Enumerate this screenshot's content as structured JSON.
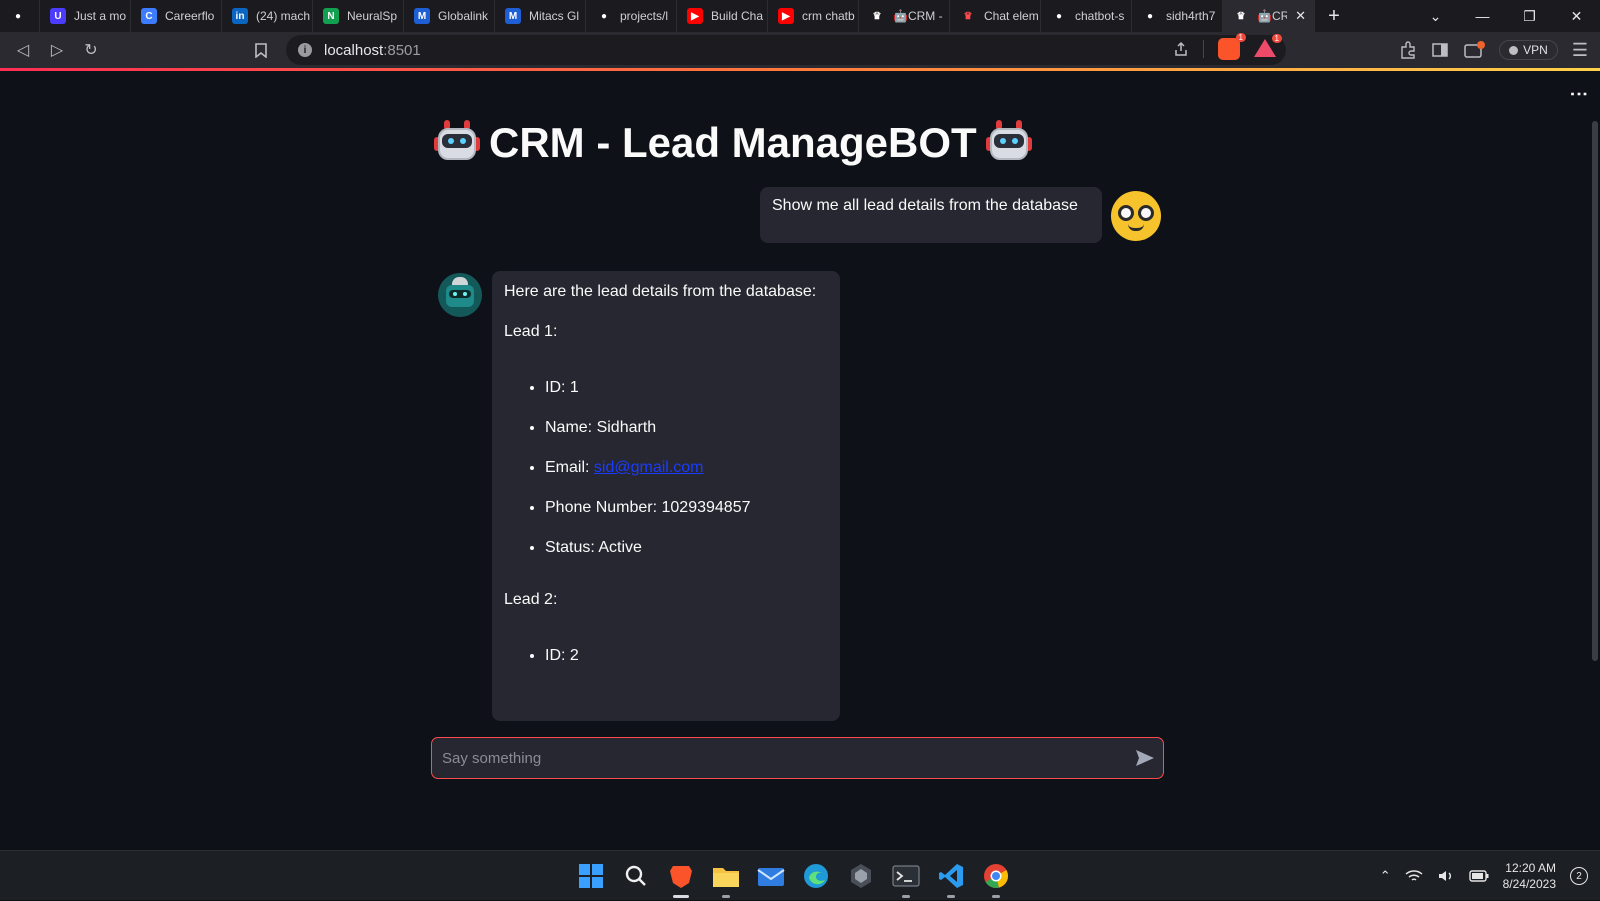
{
  "browser": {
    "tabs": [
      {
        "label": "",
        "icon": "github-icon",
        "color": "#ffffff"
      },
      {
        "label": "Just a mo",
        "icon": "un-icon",
        "color": "#4b3cff"
      },
      {
        "label": "Careerflo",
        "icon": "careerflow-icon",
        "color": "#3d7bff"
      },
      {
        "label": "(24) mach",
        "icon": "linkedin-icon",
        "color": "#0a66c2"
      },
      {
        "label": "NeuralSp",
        "icon": "neuralspace-icon",
        "color": "#12a150"
      },
      {
        "label": "Globalink",
        "icon": "mitacs-icon",
        "color": "#1f5fd6"
      },
      {
        "label": "Mitacs Gl",
        "icon": "mitacs-icon",
        "color": "#1f5fd6"
      },
      {
        "label": "projects/l",
        "icon": "github-icon",
        "color": "#ffffff"
      },
      {
        "label": "Build Cha",
        "icon": "youtube-icon",
        "color": "#ff0000"
      },
      {
        "label": "crm chatb",
        "icon": "youtube-icon",
        "color": "#ff0000"
      },
      {
        "label": "🤖CRM -",
        "icon": "streamlit-icon",
        "color": "#ffffff"
      },
      {
        "label": "Chat elem",
        "icon": "streamlit-icon",
        "color": "#ff4b4b"
      },
      {
        "label": "chatbot-s",
        "icon": "github-icon",
        "color": "#ffffff"
      },
      {
        "label": "sidh4rth7",
        "icon": "github-icon",
        "color": "#ffffff"
      },
      {
        "label": "🤖CR",
        "icon": "streamlit-icon",
        "color": "#ffffff",
        "active": true
      }
    ],
    "url_host": "localhost",
    "url_port": ":8501",
    "brave_count": "1",
    "alert_count": "1",
    "vpn_label": "VPN"
  },
  "app": {
    "title": "CRM - Lead ManageBOT",
    "user_message": "Show me all lead details from the database",
    "bot": {
      "intro": "Here are the lead details from the database:",
      "lead1_heading": "Lead 1:",
      "lead1_items": {
        "id": "ID: 1",
        "name": "Name: Sidharth",
        "email_label": "Email: ",
        "email_link": "sid@gmail.com",
        "phone": "Phone Number: 1029394857",
        "status": "Status: Active"
      },
      "lead2_heading": "Lead 2:",
      "lead2_partial": "ID: 2"
    },
    "input_placeholder": "Say something"
  },
  "taskbar": {
    "time": "12:20 AM",
    "date": "8/24/2023",
    "notifications": "2"
  },
  "colors": {
    "app_bg": "#0e1117",
    "bubble_bg": "#262730",
    "accent": "#ff4b4b",
    "link": "#1a3cff"
  }
}
